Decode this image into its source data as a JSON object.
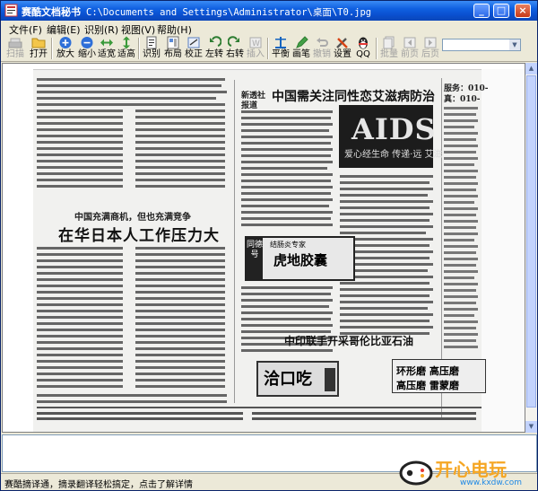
{
  "window": {
    "title_app": "赛酷文档秘书",
    "title_path": "C:\\Documents and Settings\\Administrator\\桌面\\T0.jpg",
    "buttons": {
      "minimize": "_",
      "maximize": "□",
      "close": "×"
    }
  },
  "menu": [
    {
      "label": "文件(F)"
    },
    {
      "label": "编辑(E)"
    },
    {
      "label": "识别(R)"
    },
    {
      "label": "视图(V)"
    },
    {
      "label": "帮助(H)"
    }
  ],
  "toolbar": [
    {
      "label": "扫描",
      "icon": "scanner-icon",
      "enabled": false
    },
    {
      "label": "打开",
      "icon": "folder-open-icon",
      "enabled": true
    },
    {
      "label": "放大",
      "icon": "zoom-in-icon",
      "enabled": true
    },
    {
      "label": "缩小",
      "icon": "zoom-out-icon",
      "enabled": true
    },
    {
      "label": "适宽",
      "icon": "fit-width-icon",
      "enabled": true
    },
    {
      "label": "适高",
      "icon": "fit-height-icon",
      "enabled": true
    },
    {
      "label": "识别",
      "icon": "recognize-icon",
      "enabled": true
    },
    {
      "label": "布局",
      "icon": "layout-icon",
      "enabled": true
    },
    {
      "label": "校正",
      "icon": "correct-icon",
      "enabled": true
    },
    {
      "label": "左转",
      "icon": "rotate-left-icon",
      "enabled": true
    },
    {
      "label": "右转",
      "icon": "rotate-right-icon",
      "enabled": true
    },
    {
      "label": "插入",
      "icon": "insert-icon",
      "enabled": false
    },
    {
      "label": "平衡",
      "icon": "balance-icon",
      "enabled": true
    },
    {
      "label": "画笔",
      "icon": "pen-icon",
      "enabled": true
    },
    {
      "label": "撤销",
      "icon": "undo-icon",
      "enabled": false
    },
    {
      "label": "设置",
      "icon": "settings-tools-icon",
      "enabled": true
    },
    {
      "label": "QQ",
      "icon": "qq-penguin-icon",
      "enabled": true
    },
    {
      "label": "批量",
      "icon": "batch-icon",
      "enabled": false
    },
    {
      "label": "前页",
      "icon": "prev-page-icon",
      "enabled": false
    },
    {
      "label": "后页",
      "icon": "next-page-icon",
      "enabled": false
    }
  ],
  "zoom_select": {
    "value": ""
  },
  "newspaper": {
    "headline_main": "中国需关注同性恋艾滋病防治",
    "aids_label": "AIDS",
    "aids_sub": "爱心经生命 传递·远 艾滋",
    "subhead_left": "中国充满商机，但也充满竞争",
    "headline_left": "在华日本人工作压力大",
    "ad_title": "虎地胶囊",
    "ad_side": "同德号",
    "ad_top": "结肠炎专家",
    "headline_bottom": "中印联手开采哥伦比亚石油",
    "ring_line1": "环形磨 高压磨",
    "ring_line2": "高压磨 雷蒙磨",
    "eat_title": "洽口吃",
    "right_top": "服务：010-",
    "right_top2": "真：010-",
    "col_label": "新透社",
    "col_label2": "报道"
  },
  "status": {
    "text": "赛酷摘译通，摘录翻译轻松搞定，点击了解详情"
  },
  "watermark": {
    "main": "开心电玩",
    "url": "www.kxdw.com"
  },
  "colors": {
    "titlebar": "#0a50d0",
    "chrome": "#ece9d8",
    "watermark": "#f5a623"
  }
}
